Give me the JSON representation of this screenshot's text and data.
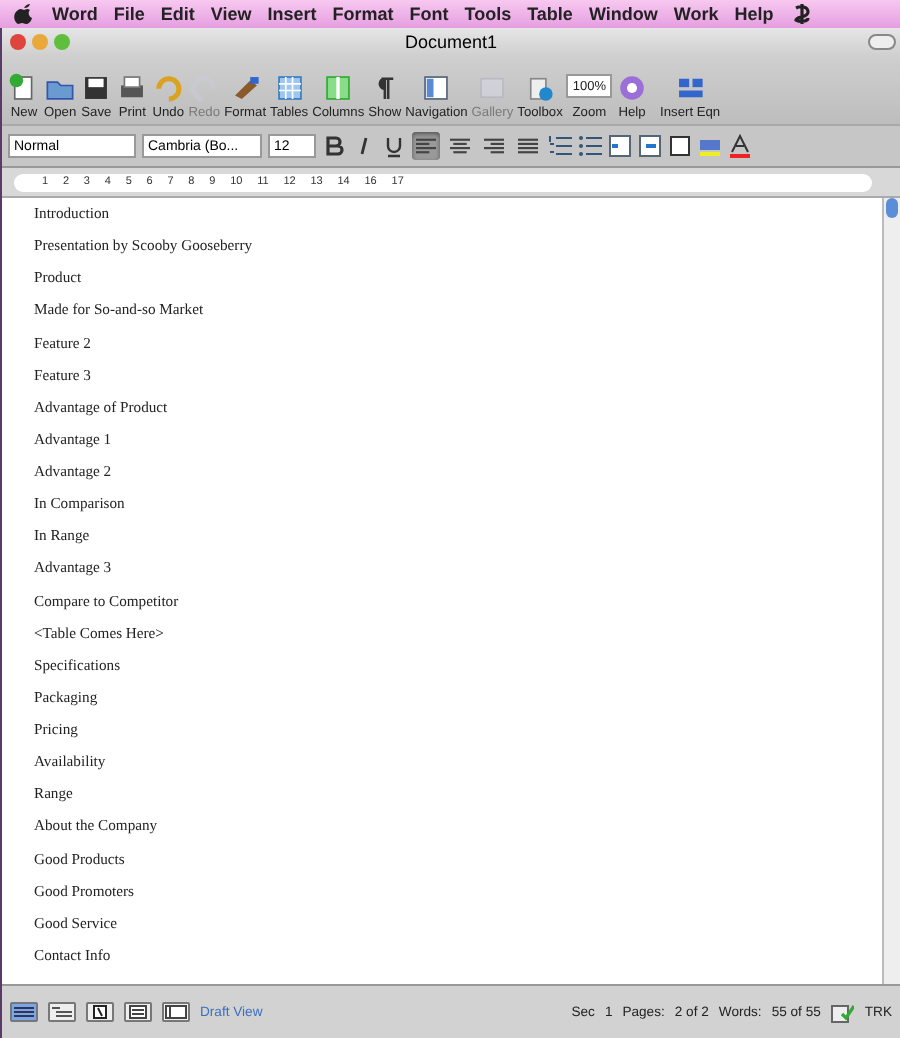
{
  "menu_bar": {
    "app": "Word",
    "items": [
      "File",
      "Edit",
      "View",
      "Insert",
      "Format",
      "Font",
      "Tools",
      "Table",
      "Window",
      "Work",
      "Help"
    ]
  },
  "window": {
    "title": "Document1"
  },
  "toolbar": [
    {
      "label": "New",
      "kind": "new",
      "disabled": false
    },
    {
      "label": "Open",
      "kind": "open",
      "disabled": false
    },
    {
      "label": "Save",
      "kind": "save",
      "disabled": false
    },
    {
      "label": "Print",
      "kind": "print",
      "disabled": false
    },
    {
      "label": "Undo",
      "kind": "undo",
      "disabled": false
    },
    {
      "label": "Redo",
      "kind": "redo",
      "disabled": true
    },
    {
      "label": "Format",
      "kind": "format",
      "disabled": false
    },
    {
      "label": "Tables",
      "kind": "tables",
      "disabled": false
    },
    {
      "label": "Columns",
      "kind": "columns",
      "disabled": false
    },
    {
      "label": "Show",
      "kind": "show",
      "disabled": false
    },
    {
      "label": "Navigation",
      "kind": "navigation",
      "disabled": false
    },
    {
      "label": "Gallery",
      "kind": "gallery",
      "disabled": true
    },
    {
      "label": "Toolbox",
      "kind": "toolbox",
      "disabled": false
    },
    {
      "label": "Zoom",
      "kind": "zoom",
      "value": "100%",
      "disabled": false
    },
    {
      "label": "Help",
      "kind": "help",
      "disabled": false
    },
    {
      "label": "Insert Eqn",
      "kind": "equation",
      "disabled": false
    }
  ],
  "formatting": {
    "style": "Normal",
    "font": "Cambria (Bo...",
    "size": "12",
    "alignment": [
      {
        "kind": "left",
        "selected": true
      },
      {
        "kind": "center",
        "selected": false
      },
      {
        "kind": "right",
        "selected": false
      },
      {
        "kind": "justify",
        "selected": false
      }
    ]
  },
  "ruler": {
    "labels": [
      "1",
      "2",
      "3",
      "4",
      "5",
      "6",
      "7",
      "8",
      "9",
      "10",
      "11",
      "12",
      "13",
      "14",
      "16",
      "17"
    ]
  },
  "document": {
    "lines": [
      "Introduction",
      "Presentation by Scooby Gooseberry",
      "Product",
      "Made for So-and-so Market",
      "Feature 2",
      "Feature 3",
      "Advantage of Product",
      "Advantage 1",
      "Advantage 2",
      "In Comparison",
      "In Range",
      "Advantage 3",
      "Compare to Competitor",
      "<Table Comes Here>",
      "Specifications",
      "Packaging",
      "Pricing",
      "Availability",
      "Range",
      "About the Company",
      "Good Products",
      "Good Promoters",
      "Good Service",
      "Contact Info"
    ]
  },
  "status_bar": {
    "views": [
      {
        "kind": "draft",
        "selected": true
      },
      {
        "kind": "outline",
        "selected": false
      },
      {
        "kind": "publishing",
        "selected": false
      },
      {
        "kind": "print",
        "selected": false
      },
      {
        "kind": "notebook",
        "selected": false
      }
    ],
    "view_name": "Draft View",
    "section_label": "Sec",
    "section": "1",
    "pages_label": "Pages:",
    "pages": "2 of 2",
    "words_label": "Words:",
    "words": "55 of 55",
    "track": "TRK"
  }
}
